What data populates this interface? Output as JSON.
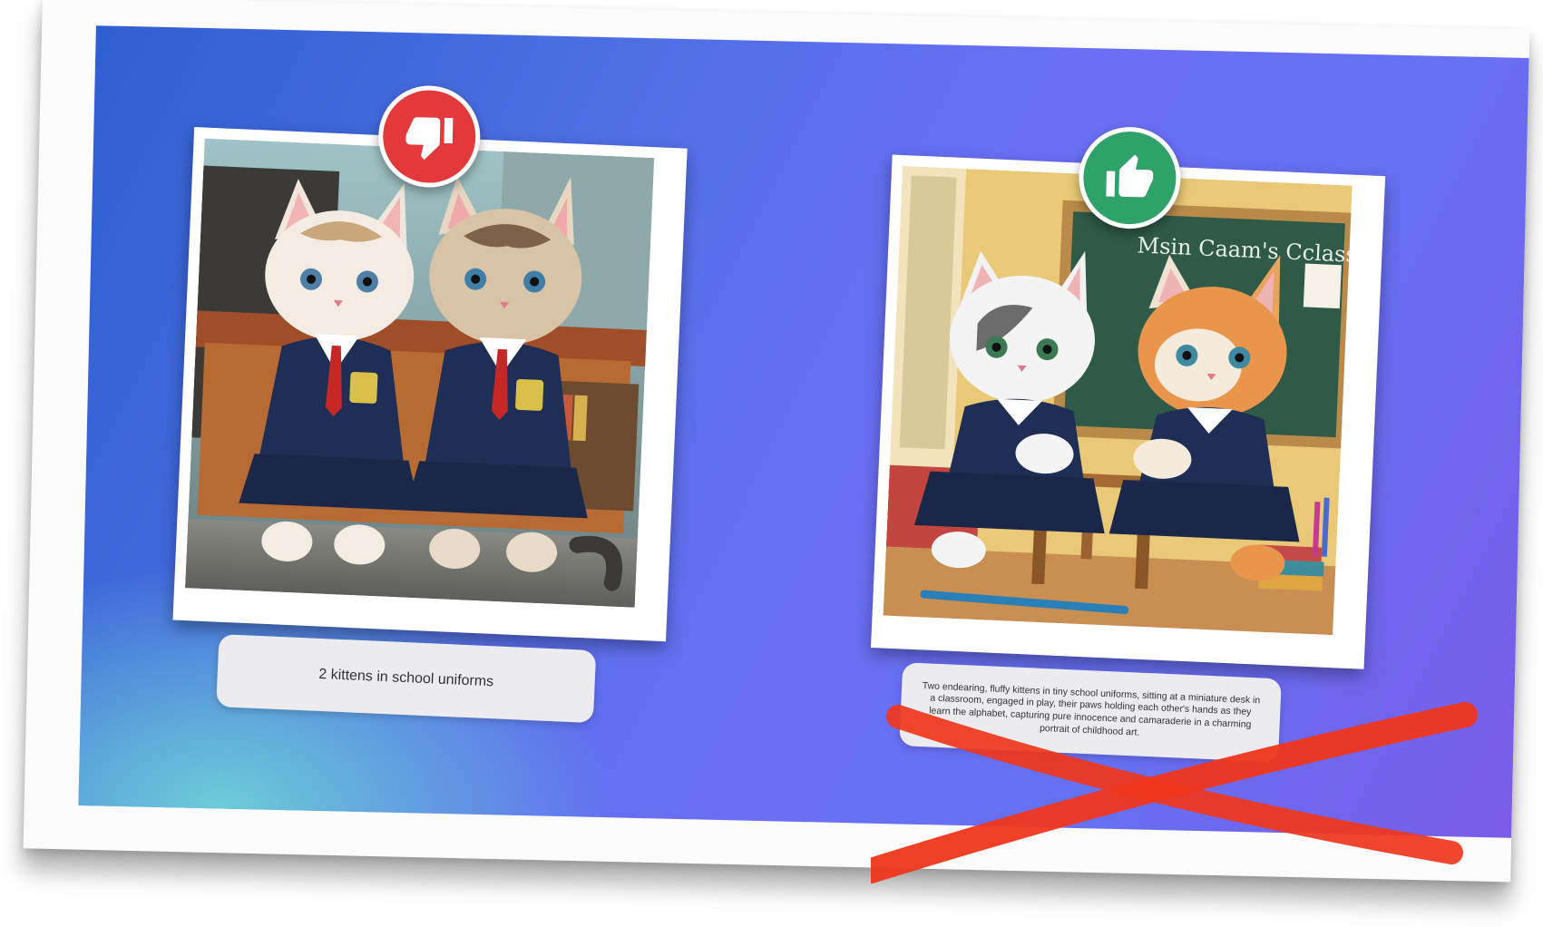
{
  "left_panel": {
    "vote": "thumbs-down",
    "vote_color": "#e23a3c",
    "caption": "2 kittens in school uniforms"
  },
  "right_panel": {
    "vote": "thumbs-up",
    "vote_color": "#2fa26a",
    "chalkboard_text": "Msin Caam's Cclassoor",
    "caption": "Two endearing, fluffy kittens in tiny school uniforms, sitting at a miniature desk in a classroom, engaged in play, their paws holding each other's hands as they learn the alphabet, capturing pure innocence and camaraderie in a charming portrait of childhood art.",
    "caption_rejected": true,
    "rejection_mark_color": "#f0361c"
  }
}
